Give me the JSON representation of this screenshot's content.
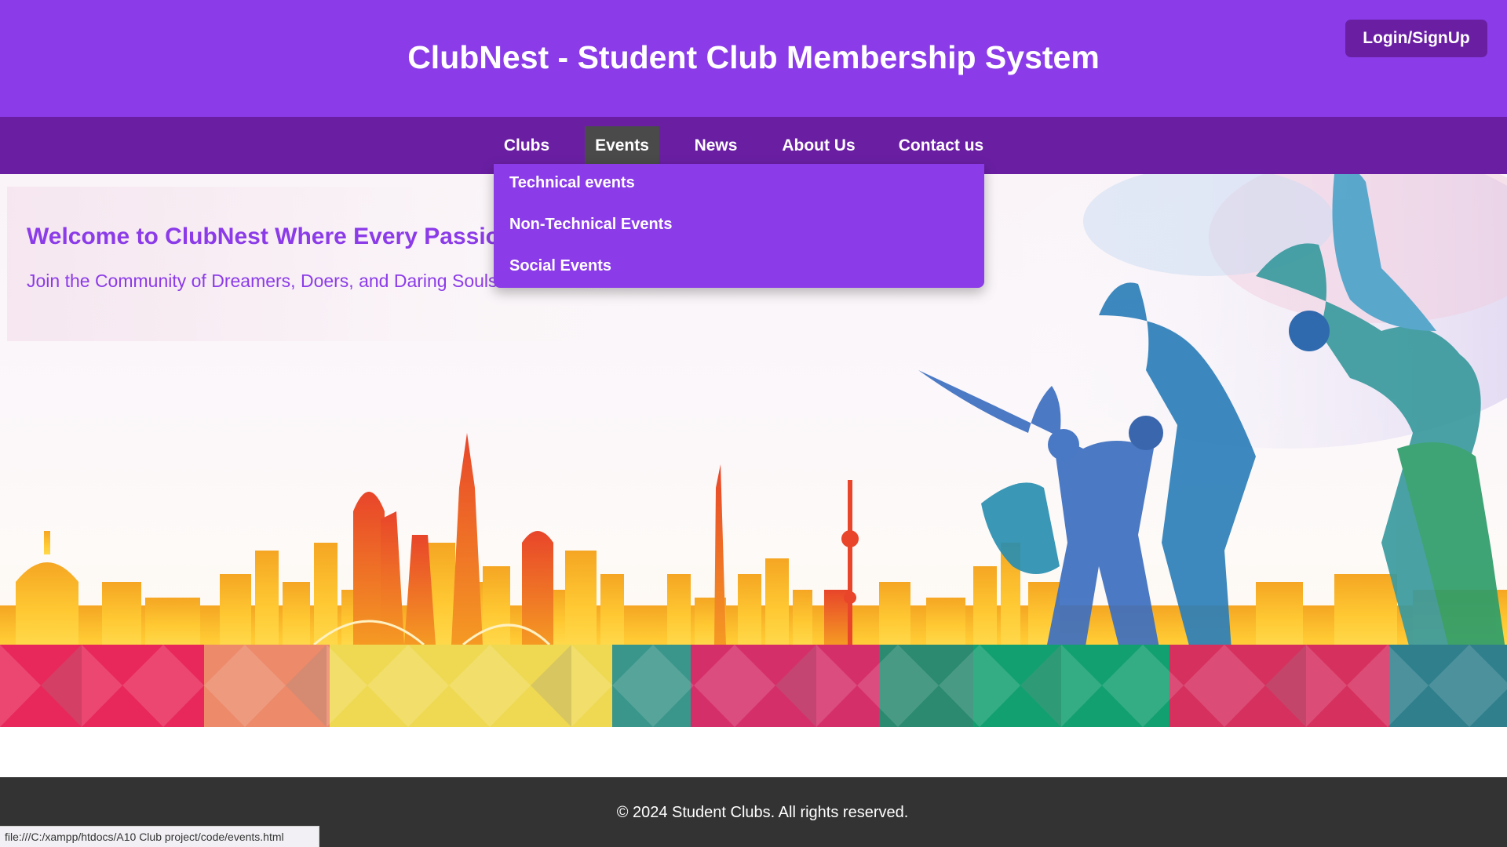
{
  "header": {
    "title": "ClubNest - Student Club Membership System",
    "login_label": "Login/SignUp"
  },
  "nav": {
    "items": [
      {
        "label": "Clubs",
        "active": false
      },
      {
        "label": "Events",
        "active": true
      },
      {
        "label": "News",
        "active": false
      },
      {
        "label": "About Us",
        "active": false
      },
      {
        "label": "Contact us",
        "active": false
      }
    ],
    "dropdown": [
      {
        "label": "Technical events"
      },
      {
        "label": "Non-Technical Events"
      },
      {
        "label": "Social Events"
      }
    ]
  },
  "hero": {
    "title": "Welcome to ClubNest Where Every Passion Finds Its Home",
    "subtitle": "Join the Community of Dreamers, Doers, and Daring Souls"
  },
  "footer": {
    "text": "© 2024 Student Clubs. All rights reserved."
  },
  "status_bar": {
    "url": "file:///C:/xampp/htdocs/A10 Club project/code/events.html"
  },
  "colors": {
    "header_purple": "#8b3be8",
    "nav_purple": "#6a1fa3",
    "active_tab": "#4a4a4a",
    "footer_dark": "#333333"
  }
}
